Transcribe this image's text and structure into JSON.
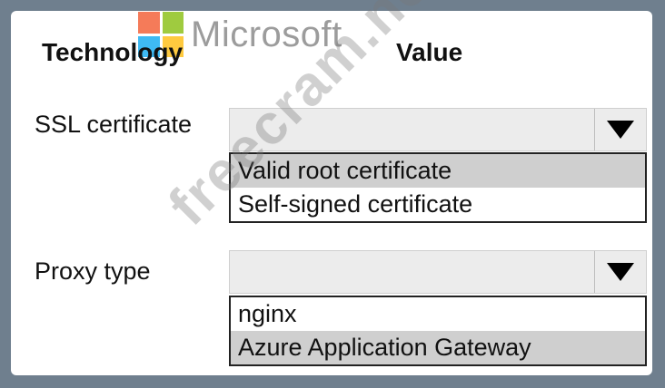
{
  "branding": {
    "logo_text": "Microsoft",
    "logo_colors": [
      "#f25022",
      "#7fba00",
      "#00a4ef",
      "#ffb900"
    ],
    "watermark": "freecram.net"
  },
  "headers": {
    "technology": "Technology",
    "value": "Value"
  },
  "rows": [
    {
      "label": "SSL certificate",
      "selected": "",
      "options": [
        "Valid root certificate",
        "Self-signed certificate"
      ],
      "highlighted_option": "Valid root certificate"
    },
    {
      "label": "Proxy type",
      "selected": "",
      "options": [
        "nginx",
        "Azure Application Gateway"
      ],
      "highlighted_option": "Azure Application Gateway"
    }
  ],
  "icons": {
    "dropdown_arrow": "chevron-down-icon"
  },
  "colors": {
    "frame": "#6f7f8e",
    "select_bg": "#ececec",
    "highlight": "#cfcfcf"
  }
}
